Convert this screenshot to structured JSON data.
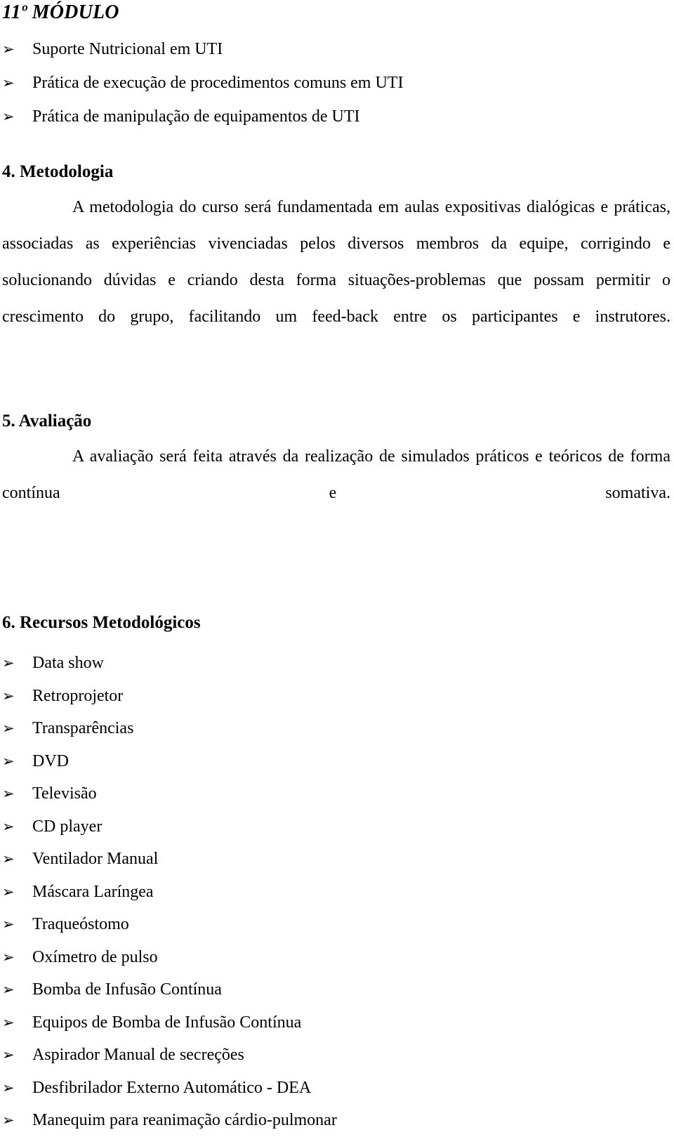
{
  "document": {
    "module_title": "11º MÓDULO",
    "module_topics": [
      "Suporte Nutricional em UTI",
      "Prática de execução de procedimentos comuns em UTI",
      "Prática de manipulação de equipamentos de UTI"
    ],
    "bullet_glyph": "➢",
    "sections": [
      {
        "heading": "4. Metodologia",
        "paragraph": "A metodologia do curso será fundamentada em aulas expositivas dialógicas e práticas, associadas as experiências vivenciadas pelos diversos membros da equipe, corrigindo e solucionando dúvidas e criando desta forma situações-problemas que possam permitir o crescimento do grupo, facilitando um feed-back entre os participantes e instrutores."
      },
      {
        "heading": "5. Avaliação",
        "paragraph": "A avaliação será feita através da realização de simulados práticos e teóricos de forma contínua e somativa."
      },
      {
        "heading": "6. Recursos Metodológicos",
        "items": [
          "Data show",
          "Retroprojetor",
          "Transparências",
          "DVD",
          "Televisão",
          "CD player",
          "Ventilador Manual",
          "Máscara Laríngea",
          "Traqueóstomo",
          "Oxímetro de pulso",
          "Bomba de Infusão Contínua",
          "Equipos de Bomba de Infusão Contínua",
          "Aspirador Manual de secreções",
          "Desfibrilador Externo Automático - DEA",
          "Manequim para reanimação cárdio-pulmonar"
        ]
      }
    ],
    "colors": {
      "text": "#000000",
      "background": "#ffffff"
    }
  }
}
